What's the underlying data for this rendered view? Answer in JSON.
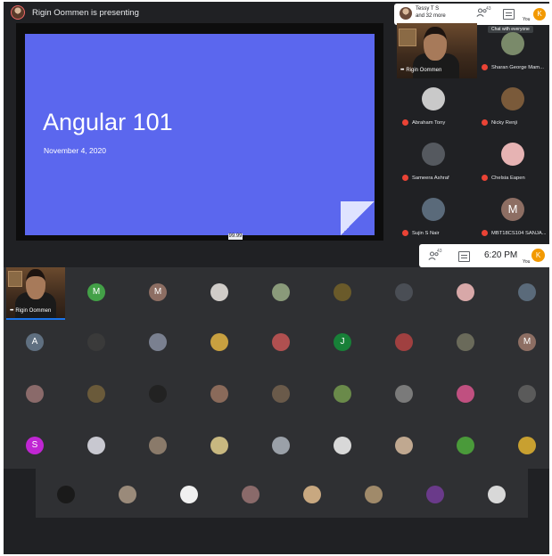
{
  "top": {
    "presenting_text": "Rigin Oommen is presenting",
    "slide": {
      "title": "Angular 101",
      "date": "November 4, 2020",
      "zoom_label": "99.99"
    },
    "header": {
      "viewer_name": "Tessy T S",
      "viewer_more": "and 32 more",
      "people_count": "43",
      "avatar_letter": "K",
      "you_label": "You"
    },
    "tooltip": "Chat with everyone",
    "self_tile": {
      "name": "Rigin Oommen"
    },
    "participants": [
      {
        "name": "Sharan George Mam...",
        "avatar_color": "#7a8a6a"
      },
      {
        "name": "Abraham Tony",
        "avatar_color": "#c9c9c9"
      },
      {
        "name": "Nicky Renji",
        "avatar_color": "#7a5a3a"
      },
      {
        "name": "Sameera Ashraf",
        "avatar_color": "#55595f"
      },
      {
        "name": "Chelsia Eapen",
        "avatar_color": "#e6b3b3"
      },
      {
        "name": "Sujin S Nair",
        "avatar_color": "#5a6a7a"
      },
      {
        "name": "MBT18CS104 SANJA...",
        "avatar_color": "#8d6e63",
        "letter": "M"
      }
    ]
  },
  "bottom": {
    "header": {
      "people_count": "43",
      "time": "6:20 PM",
      "avatar_letter": "K",
      "you_label": "You"
    },
    "self_tile": {
      "name": "Rigin Oommen"
    },
    "grid": [
      [
        {
          "color": "#43a047",
          "letter": "M"
        },
        {
          "color": "#8d6e63",
          "letter": "M"
        },
        {
          "color": "#d0ccc8"
        },
        {
          "color": "#8a9a7a"
        },
        {
          "color": "#6a5a2a"
        },
        {
          "color": "#4a4e55"
        },
        {
          "color": "#d8a8a8"
        },
        {
          "color": "#5a6a7a"
        }
      ],
      [
        {
          "color": "#5f6f80",
          "letter": "A"
        },
        {
          "color": "#3a3a3a"
        },
        {
          "color": "#7a8090"
        },
        {
          "color": "#c8a040"
        },
        {
          "color": "#b05050"
        },
        {
          "color": "#188038",
          "letter": "J"
        },
        {
          "color": "#a04040"
        },
        {
          "color": "#6a6a5a"
        },
        {
          "color": "#8d6e63",
          "letter": "M"
        }
      ],
      [
        {
          "color": "#8a6a6a"
        },
        {
          "color": "#6a5a3a"
        },
        {
          "color": "#222222"
        },
        {
          "color": "#8a6a5a"
        },
        {
          "color": "#6a5a4a"
        },
        {
          "color": "#6a8a4a"
        },
        {
          "color": "#7a7a7a"
        },
        {
          "color": "#c05080"
        },
        {
          "color": "#5a5a5a"
        }
      ],
      [
        {
          "color": "#c026d3",
          "letter": "S"
        },
        {
          "color": "#c8c8d0"
        },
        {
          "color": "#8a7a6a"
        },
        {
          "color": "#c8b880"
        },
        {
          "color": "#9aa0a8"
        },
        {
          "color": "#d8d8d8"
        },
        {
          "color": "#c0a890"
        },
        {
          "color": "#4a9a3a"
        },
        {
          "color": "#c8a030"
        }
      ],
      [
        {
          "color": "#1a1a1a"
        },
        {
          "color": "#9a8a7a"
        },
        {
          "color": "#f0f0f0"
        },
        {
          "color": "#8a6a6a"
        },
        {
          "color": "#c8a880"
        },
        {
          "color": "#a08a6a"
        },
        {
          "color": "#6a3a8a"
        },
        {
          "color": "#d8d8d8"
        }
      ]
    ]
  }
}
